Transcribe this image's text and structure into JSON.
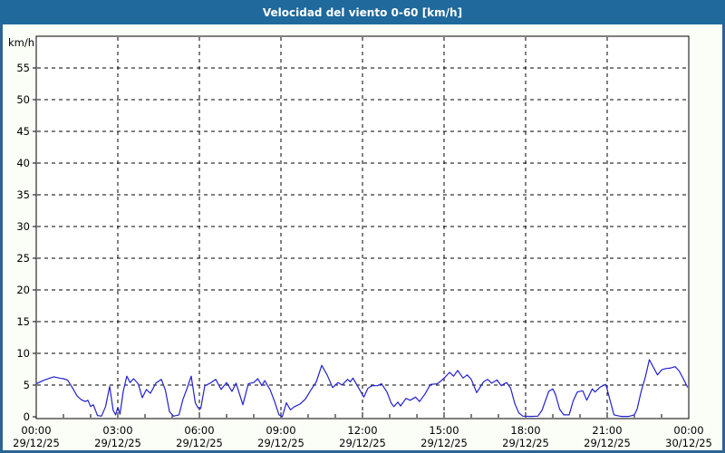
{
  "header": {
    "title": "Velocidad del viento 0-60 [km/h]"
  },
  "colors": {
    "header_bg": "#1f699c",
    "page_border": "#2a6594",
    "page_bg": "#fbfdf7",
    "plot_bg": "#ffffff",
    "plot_border": "#000000",
    "grid": "#000000",
    "tick": "#000000",
    "text": "#000000",
    "line": "#2121cd"
  },
  "chart_data": {
    "type": "line",
    "title": "Velocidad del viento 0-60 [km/h]",
    "xlabel": "",
    "ylabel": "km/h",
    "ylim": [
      0,
      60
    ],
    "xlim_hours": [
      0,
      24
    ],
    "grid": "dashed",
    "legend": "none",
    "y_ticks": [
      0,
      5,
      10,
      15,
      20,
      25,
      30,
      35,
      40,
      45,
      50,
      55
    ],
    "x_ticks": [
      {
        "hour": 0,
        "time": "00:00",
        "date": "29/12/25"
      },
      {
        "hour": 3,
        "time": "03:00",
        "date": "29/12/25"
      },
      {
        "hour": 6,
        "time": "06:00",
        "date": "29/12/25"
      },
      {
        "hour": 9,
        "time": "09:00",
        "date": "29/12/25"
      },
      {
        "hour": 12,
        "time": "12:00",
        "date": "29/12/25"
      },
      {
        "hour": 15,
        "time": "15:00",
        "date": "29/12/25"
      },
      {
        "hour": 18,
        "time": "18:00",
        "date": "29/12/25"
      },
      {
        "hour": 21,
        "time": "21:00",
        "date": "29/12/25"
      },
      {
        "hour": 24,
        "time": "00:00",
        "date": "30/12/25"
      }
    ],
    "minor_tick_step_hours": 1,
    "series": [
      {
        "name": "Velocidad del viento",
        "color": "#2121cd",
        "points": [
          [
            0,
            5.2
          ],
          [
            0.25,
            5.7
          ],
          [
            0.5,
            6.1
          ],
          [
            0.65,
            6.3
          ],
          [
            0.85,
            6.1
          ],
          [
            1,
            6
          ],
          [
            1.15,
            5.8
          ],
          [
            1.3,
            4.8
          ],
          [
            1.5,
            3.3
          ],
          [
            1.65,
            2.7
          ],
          [
            1.8,
            2.4
          ],
          [
            1.9,
            2.6
          ],
          [
            2,
            1.6
          ],
          [
            2.1,
            1.9
          ],
          [
            2.25,
            0.2
          ],
          [
            2.4,
            0.1
          ],
          [
            2.55,
            1.6
          ],
          [
            2.7,
            4.8
          ],
          [
            2.83,
            1
          ],
          [
            2.92,
            0.3
          ],
          [
            3,
            1.5
          ],
          [
            3.08,
            0.4
          ],
          [
            3.2,
            4
          ],
          [
            3.33,
            6.4
          ],
          [
            3.45,
            5.4
          ],
          [
            3.58,
            6
          ],
          [
            3.75,
            5.2
          ],
          [
            3.9,
            3
          ],
          [
            4.05,
            4.3
          ],
          [
            4.2,
            3.7
          ],
          [
            4.4,
            5.3
          ],
          [
            4.6,
            5.9
          ],
          [
            4.75,
            4.2
          ],
          [
            4.9,
            0.8
          ],
          [
            5.05,
            0.1
          ],
          [
            5.25,
            0.3
          ],
          [
            5.4,
            2.8
          ],
          [
            5.55,
            4.5
          ],
          [
            5.7,
            6.4
          ],
          [
            5.85,
            2.2
          ],
          [
            5.95,
            1.4
          ],
          [
            6.05,
            1.3
          ],
          [
            6.2,
            4.9
          ],
          [
            6.4,
            5.3
          ],
          [
            6.6,
            5.9
          ],
          [
            6.8,
            4.3
          ],
          [
            7,
            5.4
          ],
          [
            7.2,
            4
          ],
          [
            7.35,
            5.3
          ],
          [
            7.6,
            1.9
          ],
          [
            7.8,
            5.2
          ],
          [
            8,
            5.4
          ],
          [
            8.15,
            6
          ],
          [
            8.3,
            4.9
          ],
          [
            8.4,
            5.7
          ],
          [
            8.6,
            4.3
          ],
          [
            8.75,
            2.6
          ],
          [
            8.93,
            0.3
          ],
          [
            9.05,
            0
          ],
          [
            9.2,
            2.2
          ],
          [
            9.35,
            1.1
          ],
          [
            9.5,
            1.6
          ],
          [
            9.7,
            2
          ],
          [
            9.9,
            2.8
          ],
          [
            10.1,
            4.2
          ],
          [
            10.3,
            5.5
          ],
          [
            10.5,
            8.1
          ],
          [
            10.7,
            6.6
          ],
          [
            10.9,
            4.6
          ],
          [
            11.1,
            5.4
          ],
          [
            11.25,
            5
          ],
          [
            11.45,
            5.9
          ],
          [
            11.55,
            5.5
          ],
          [
            11.65,
            6.1
          ],
          [
            11.85,
            4.6
          ],
          [
            12.05,
            3.1
          ],
          [
            12.2,
            4.5
          ],
          [
            12.35,
            4.9
          ],
          [
            12.55,
            4.9
          ],
          [
            12.7,
            5.2
          ],
          [
            12.9,
            3.9
          ],
          [
            13.05,
            2.2
          ],
          [
            13.15,
            1.6
          ],
          [
            13.3,
            2.3
          ],
          [
            13.4,
            1.7
          ],
          [
            13.6,
            2.9
          ],
          [
            13.75,
            2.6
          ],
          [
            13.95,
            3.1
          ],
          [
            14.1,
            2.4
          ],
          [
            14.3,
            3.6
          ],
          [
            14.5,
            5.1
          ],
          [
            14.75,
            5.2
          ],
          [
            14.9,
            5.7
          ],
          [
            15.05,
            6.3
          ],
          [
            15.2,
            7
          ],
          [
            15.35,
            6.4
          ],
          [
            15.5,
            7.3
          ],
          [
            15.7,
            6.1
          ],
          [
            15.85,
            6.6
          ],
          [
            16,
            5.9
          ],
          [
            16.2,
            3.8
          ],
          [
            16.45,
            5.5
          ],
          [
            16.6,
            5.9
          ],
          [
            16.75,
            5.3
          ],
          [
            16.95,
            5.8
          ],
          [
            17.1,
            4.9
          ],
          [
            17.3,
            5.4
          ],
          [
            17.45,
            4.5
          ],
          [
            17.6,
            2.1
          ],
          [
            17.75,
            0.6
          ],
          [
            17.9,
            0.1
          ],
          [
            18.2,
            0.05
          ],
          [
            18.45,
            0.1
          ],
          [
            18.6,
            1
          ],
          [
            18.75,
            2.8
          ],
          [
            18.85,
            4
          ],
          [
            19,
            4.4
          ],
          [
            19.1,
            3.5
          ],
          [
            19.25,
            1.2
          ],
          [
            19.4,
            0.3
          ],
          [
            19.6,
            0.3
          ],
          [
            19.75,
            2.5
          ],
          [
            19.9,
            3.9
          ],
          [
            20.1,
            4.1
          ],
          [
            20.25,
            2.6
          ],
          [
            20.45,
            4.4
          ],
          [
            20.55,
            3.9
          ],
          [
            20.75,
            4.7
          ],
          [
            20.95,
            5.1
          ],
          [
            21.1,
            2.7
          ],
          [
            21.25,
            0.3
          ],
          [
            21.5,
            0.05
          ],
          [
            21.8,
            0.05
          ],
          [
            22,
            0.3
          ],
          [
            22.1,
            1.2
          ],
          [
            22.25,
            4
          ],
          [
            22.4,
            6.2
          ],
          [
            22.55,
            9
          ],
          [
            22.85,
            6.6
          ],
          [
            23,
            7.4
          ],
          [
            23.15,
            7.6
          ],
          [
            23.35,
            7.7
          ],
          [
            23.5,
            7.9
          ],
          [
            23.65,
            7.2
          ],
          [
            23.8,
            6
          ],
          [
            23.95,
            4.7
          ]
        ]
      }
    ]
  }
}
